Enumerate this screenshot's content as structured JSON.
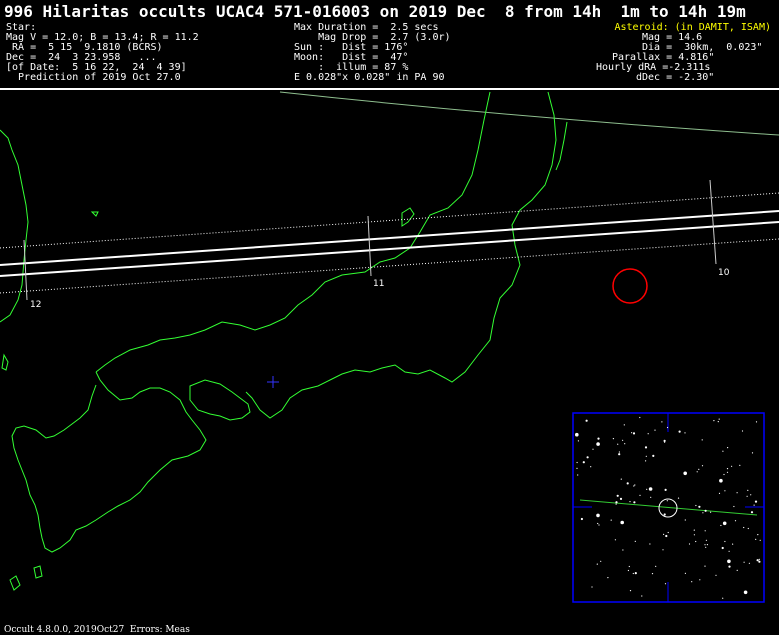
{
  "header": {
    "title": "996 Hilaritas occults UCAC4 571-016003 on 2019 Dec  8 from 14h  1m to 14h 19m",
    "star": {
      "label": "Star:",
      "mag": "Mag V = 12.0; B = 13.4; R = 11.2",
      "ra": " RA =  5 15  9.1810 (BCRS)",
      "dec": "Dec =  24  3 23.958   ...",
      "of_date": "[of Date:  5 16 22,  24  4 39]",
      "prediction": "  Prediction of 2019 Oct 27.0"
    },
    "event": {
      "max_duration": "Max Duration =  2.5 secs",
      "mag_drop": "    Mag Drop =  2.7 (3.0r)",
      "sun": "Sun :   Dist = 176°",
      "moon": "Moon:   Dist =  47°",
      "illum": "    :  illum = 87 %",
      "error_ellipse": "E 0.028\"x 0.028\" in PA 90"
    },
    "asteroid": {
      "label": "Asteroid: (in DAMIT, ISAM)",
      "mag": "Mag = 14.6",
      "dia": "Dia =  30km,  0.023\"",
      "parallax": "Parallax = 4.816\"",
      "hourly_dra": "Hourly dRA =-2.311s",
      "ddec": "dDec = -2.30\""
    }
  },
  "map": {
    "time_labels": [
      "12",
      "11",
      "10"
    ],
    "colors": {
      "coastline": "#33ff33",
      "path": "#ffffff",
      "sigma_lines": "#ffffff",
      "circle": "#ff0000",
      "cross": "#3333ff",
      "starchart_frame": "#0000ff"
    }
  },
  "footer": "Occult 4.8.0.0, 2019Oct27  Errors: Meas"
}
